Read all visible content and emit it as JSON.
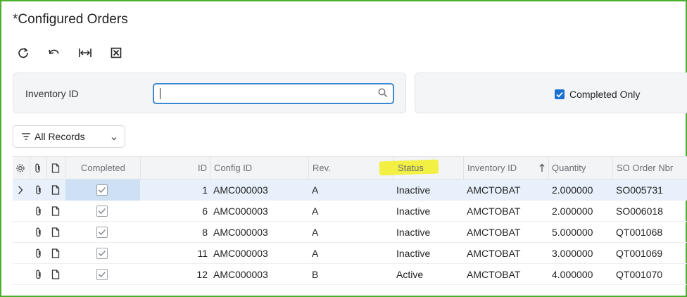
{
  "page": {
    "title": "*Configured Orders"
  },
  "toolbar": {
    "buttons": [
      {
        "name": "refresh-button",
        "icon": "refresh-icon"
      },
      {
        "name": "undo-button",
        "icon": "undo-icon"
      },
      {
        "name": "fit-width-button",
        "icon": "fit-to-width-icon"
      },
      {
        "name": "export-excel-button",
        "icon": "excel-icon"
      }
    ]
  },
  "filters": {
    "inventory_label": "Inventory ID",
    "inventory_value": "",
    "inventory_placeholder": "",
    "completed_only_label": "Completed Only",
    "completed_only_checked": true
  },
  "records": {
    "selected": "All Records"
  },
  "grid": {
    "columns": {
      "settings_icon": "gear-icon",
      "attach_icon": "paperclip-icon",
      "notes_icon": "document-icon",
      "completed": "Completed",
      "id": "ID",
      "config_id": "Config ID",
      "rev": "Rev.",
      "status": "Status",
      "inventory_id": "Inventory ID",
      "quantity": "Quantity",
      "so_order_nbr": "SO Order Nbr"
    },
    "sort": {
      "column": "inventory_id",
      "direction": "ascending"
    },
    "rows": [
      {
        "completed": true,
        "id": "1",
        "config_id": "AMC000003",
        "rev": "A",
        "status": "Inactive",
        "inventory_id": "AMCTOBAT",
        "quantity": "2.000000",
        "so_order_nbr": "SO005731"
      },
      {
        "completed": true,
        "id": "6",
        "config_id": "AMC000003",
        "rev": "A",
        "status": "Inactive",
        "inventory_id": "AMCTOBAT",
        "quantity": "2.000000",
        "so_order_nbr": "SO006018"
      },
      {
        "completed": true,
        "id": "8",
        "config_id": "AMC000003",
        "rev": "A",
        "status": "Inactive",
        "inventory_id": "AMCTOBAT",
        "quantity": "5.000000",
        "so_order_nbr": "QT001068"
      },
      {
        "completed": true,
        "id": "11",
        "config_id": "AMC000003",
        "rev": "A",
        "status": "Inactive",
        "inventory_id": "AMCTOBAT",
        "quantity": "3.000000",
        "so_order_nbr": "QT001069"
      },
      {
        "completed": true,
        "id": "12",
        "config_id": "AMC000003",
        "rev": "B",
        "status": "Active",
        "inventory_id": "AMCTOBAT",
        "quantity": "4.000000",
        "so_order_nbr": "QT001070"
      }
    ]
  },
  "colors": {
    "accent": "#3c87d1",
    "checkbox": "#1a6fcf",
    "frame": "#4ab02a",
    "highlight": "#f3f044",
    "active_row": "#e8f1fb"
  }
}
